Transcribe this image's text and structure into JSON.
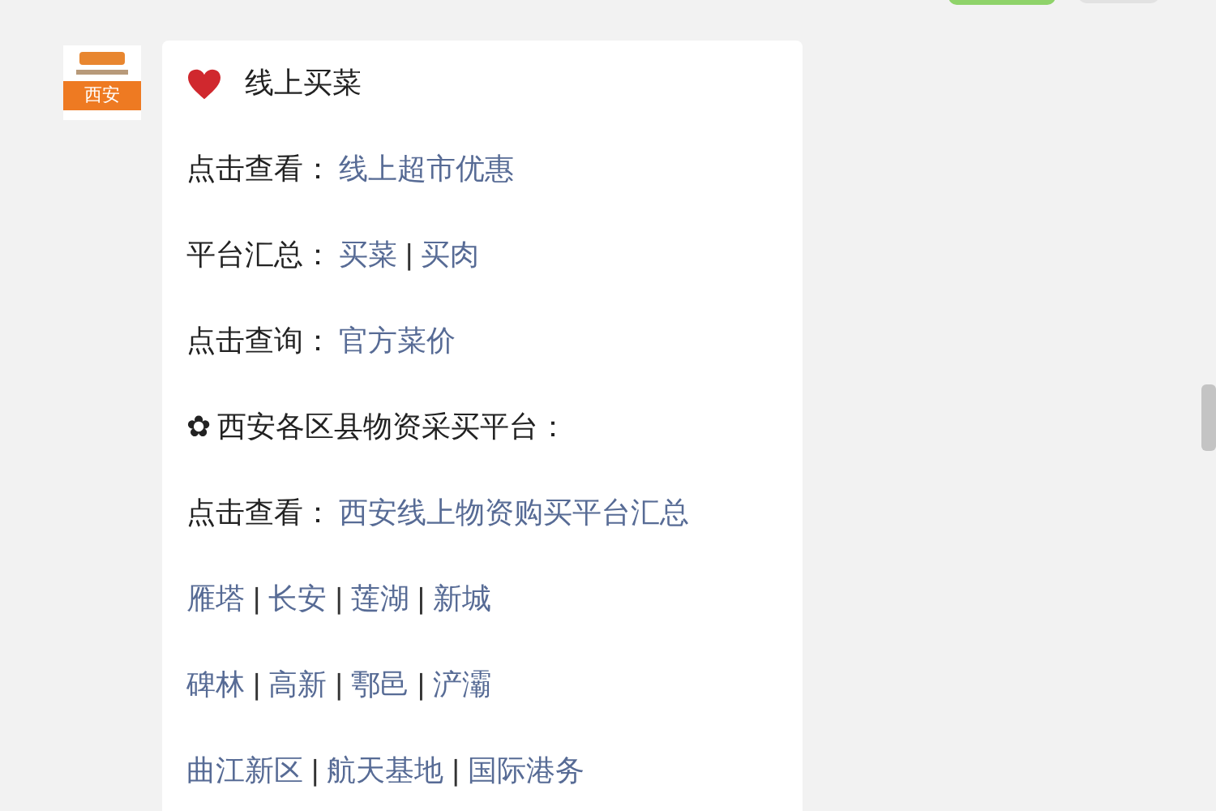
{
  "avatar": {
    "label": "西安"
  },
  "message": {
    "lines": [
      {
        "kind": "heading",
        "parts": [
          {
            "kind": "text",
            "text": "线上买菜"
          }
        ]
      },
      {
        "kind": "row",
        "parts": [
          {
            "kind": "text",
            "text": "点击查看："
          },
          {
            "kind": "link",
            "text": "线上超市优惠"
          }
        ]
      },
      {
        "kind": "row",
        "parts": [
          {
            "kind": "text",
            "text": "平台汇总："
          },
          {
            "kind": "link",
            "text": "买菜"
          },
          {
            "kind": "sep",
            "text": "|"
          },
          {
            "kind": "link",
            "text": "买肉"
          }
        ]
      },
      {
        "kind": "row",
        "parts": [
          {
            "kind": "text",
            "text": "点击查询："
          },
          {
            "kind": "link",
            "text": "官方菜价"
          }
        ]
      },
      {
        "kind": "row",
        "parts": [
          {
            "kind": "text",
            "text": "✿"
          },
          {
            "kind": "text",
            "text": "西安各区县物资采买平台："
          }
        ]
      },
      {
        "kind": "row",
        "parts": [
          {
            "kind": "text",
            "text": "点击查看："
          },
          {
            "kind": "link",
            "text": "西安线上物资购买平台汇总"
          }
        ]
      },
      {
        "kind": "row",
        "parts": [
          {
            "kind": "link",
            "text": "雁塔"
          },
          {
            "kind": "sep",
            "text": "|"
          },
          {
            "kind": "link",
            "text": "长安"
          },
          {
            "kind": "sep",
            "text": "|"
          },
          {
            "kind": "link",
            "text": "莲湖"
          },
          {
            "kind": "sep",
            "text": "|"
          },
          {
            "kind": "link",
            "text": "新城"
          }
        ]
      },
      {
        "kind": "row",
        "parts": [
          {
            "kind": "link",
            "text": "碑林"
          },
          {
            "kind": "sep",
            "text": "|"
          },
          {
            "kind": "link",
            "text": "高新"
          },
          {
            "kind": "sep",
            "text": "|"
          },
          {
            "kind": "link",
            "text": "鄠邑"
          },
          {
            "kind": "sep",
            "text": "|"
          },
          {
            "kind": "link",
            "text": "浐灞"
          }
        ]
      },
      {
        "kind": "row",
        "parts": [
          {
            "kind": "link",
            "text": "曲江新区"
          },
          {
            "kind": "sep",
            "text": "|"
          },
          {
            "kind": "link",
            "text": "航天基地"
          },
          {
            "kind": "sep",
            "text": "|"
          },
          {
            "kind": "link",
            "text": "国际港务"
          }
        ]
      }
    ]
  }
}
